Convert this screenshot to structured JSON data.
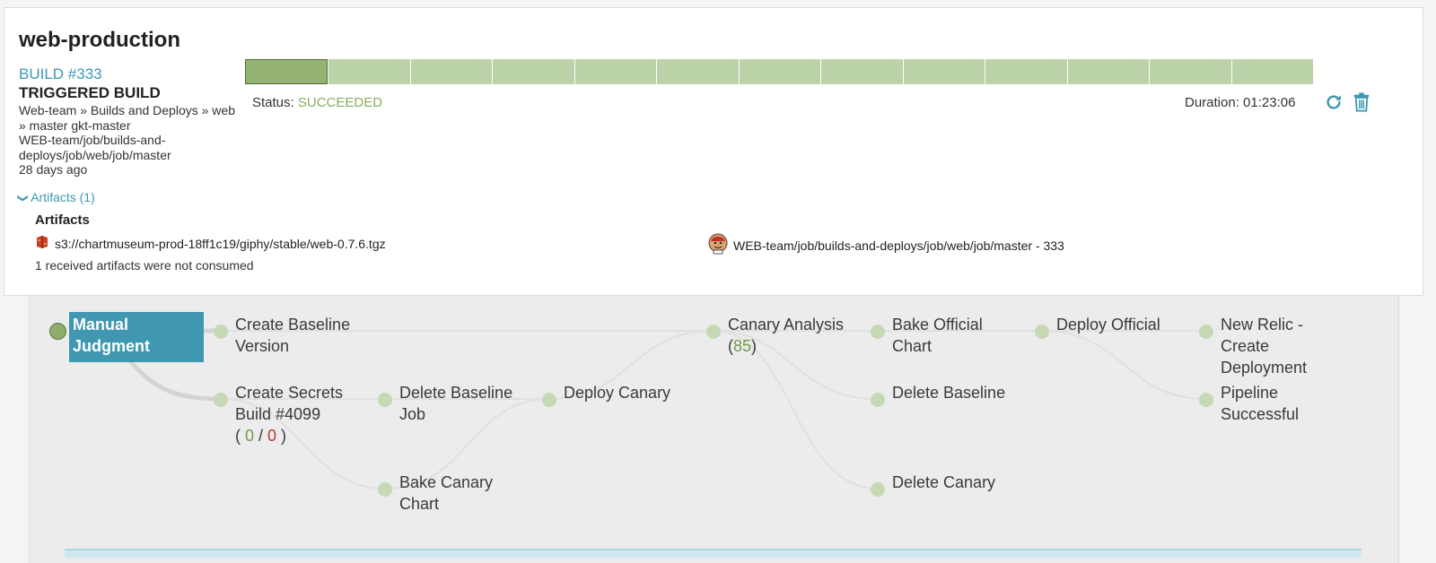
{
  "pipeline": {
    "title": "web-production"
  },
  "build": {
    "link": "BUILD #333",
    "trigger_type": "TRIGGERED BUILD",
    "details": [
      "Web-team » Builds and Deploys » web",
      "» master gkt-master",
      "WEB-team/job/builds-and-",
      "deploys/job/web/job/master",
      "28 days ago"
    ]
  },
  "progress": {
    "segments": 13,
    "active_index": 0
  },
  "status": {
    "label": "Status:",
    "value": "SUCCEEDED"
  },
  "duration": {
    "label": "Duration:",
    "value": "01:23:06"
  },
  "actions": {
    "rerun_icon": "refresh-icon",
    "delete_icon": "trash-icon"
  },
  "artifacts": {
    "toggle": "Artifacts (1)",
    "heading": "Artifacts",
    "items": [
      {
        "text": "s3://chartmuseum-prod-18ff1c19/giphy/stable/web-0.7.6.tgz",
        "icon": "s3-bucket-icon"
      },
      {
        "text": "WEB-team/job/builds-and-deploys/job/web/job/master - 333",
        "icon": "jenkins-icon"
      }
    ],
    "note": "1 received artifacts were not consumed"
  },
  "stages": {
    "manual_judgment": [
      "Manual",
      "Judgment"
    ],
    "create_baseline": [
      "Create Baseline",
      "Version"
    ],
    "create_secrets": {
      "line1": "Create Secrets",
      "line2": "Build #4099",
      "open": "( ",
      "green": "0",
      "sep": " / ",
      "red": "0",
      "close": " )"
    },
    "delete_baseline_job": [
      "Delete Baseline",
      "Job"
    ],
    "bake_canary_chart": [
      "Bake Canary",
      "Chart"
    ],
    "deploy_canary": "Deploy Canary",
    "canary_analysis": {
      "line1": "Canary Analysis",
      "open": "(",
      "score": "85",
      "close": ")"
    },
    "bake_official_chart": [
      "Bake Official",
      "Chart"
    ],
    "delete_baseline": "Delete Baseline",
    "delete_canary": "Delete Canary",
    "deploy_official": "Deploy Official",
    "new_relic": [
      "New Relic -",
      "Create",
      "Deployment"
    ],
    "pipeline_successful": [
      "Pipeline",
      "Successful"
    ]
  },
  "colors": {
    "accent": "#3f97b2",
    "success": "#87ad5f",
    "progress_fill": "#bcd2a9",
    "progress_active": "#93b273",
    "failure": "#b3382c"
  }
}
